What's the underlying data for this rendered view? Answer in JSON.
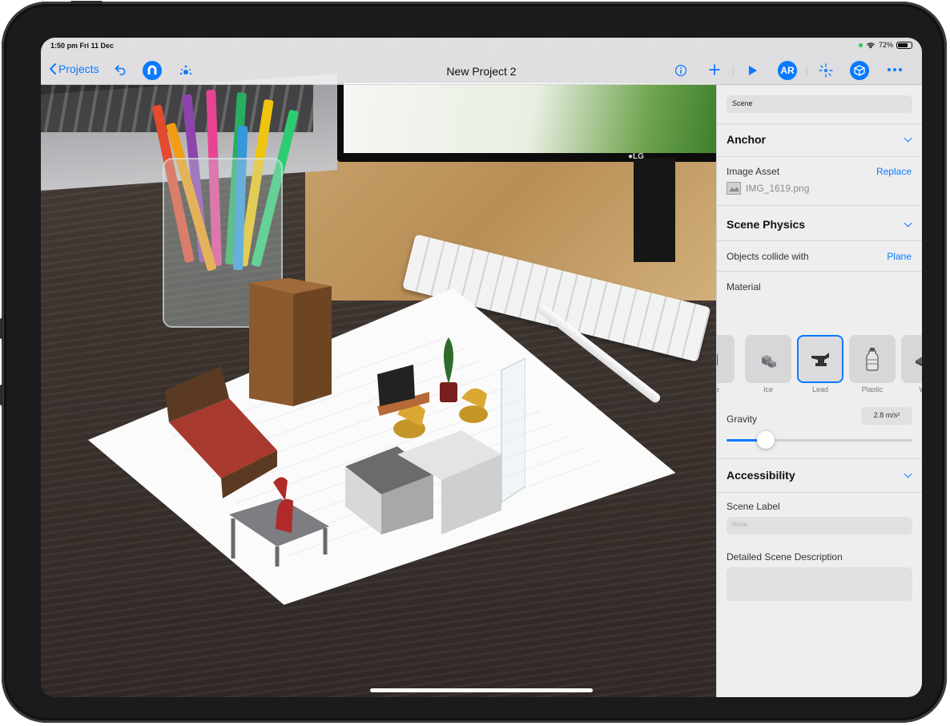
{
  "status_bar": {
    "time": "1:50 pm  Fri 11 Dec",
    "battery": "72%"
  },
  "toolbar": {
    "back_label": "Projects",
    "title": "New Project 2",
    "ar_label": "AR",
    "icons": [
      "chevron-left-icon",
      "undo-icon",
      "magnet-icon",
      "snap-icon",
      "info-icon",
      "plus-icon",
      "play-icon",
      "ar-icon",
      "scan-icon",
      "object-cube-icon",
      "more-icon"
    ]
  },
  "panel": {
    "scene_field": "Scene",
    "anchor": {
      "heading": "Anchor",
      "image_asset_label": "Image Asset",
      "replace_label": "Replace",
      "file_name": "IMG_1619.png"
    },
    "physics": {
      "heading": "Scene Physics",
      "collide_label": "Objects collide with",
      "collide_value": "Plane",
      "material_label": "Material",
      "materials": [
        {
          "label": "crete",
          "icon": "concrete-icon"
        },
        {
          "label": "Ice",
          "icon": "ice-cubes-icon"
        },
        {
          "label": "Lead",
          "icon": "anvil-icon",
          "selected": true
        },
        {
          "label": "Plastic",
          "icon": "bottle-icon"
        },
        {
          "label": "Wo",
          "icon": "wood-plank-icon"
        }
      ],
      "gravity_label": "Gravity",
      "gravity_value": "2.8 m/s²",
      "gravity_fraction": 0.21
    },
    "accessibility": {
      "heading": "Accessibility",
      "scene_label_title": "Scene Label",
      "scene_label_placeholder": "None",
      "description_title": "Detailed Scene Description"
    }
  },
  "colors": {
    "accent": "#0a7aff",
    "panel_bg": "#eeeeef",
    "toolbar_bg": "#f5f5f7"
  }
}
